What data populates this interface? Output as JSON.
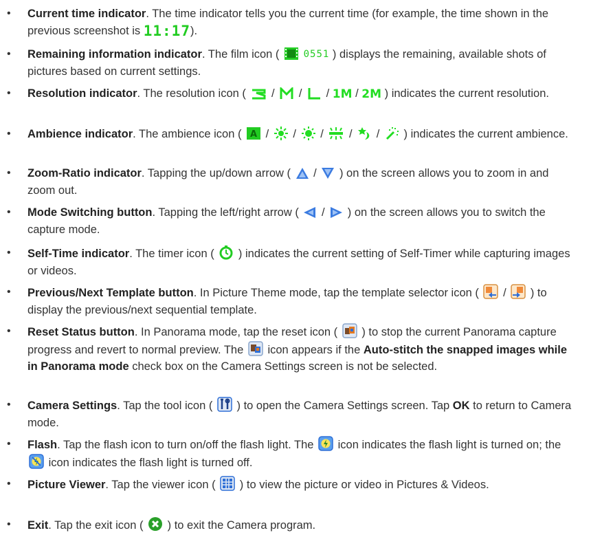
{
  "items": [
    {
      "title": "Current time indicator",
      "text_a": ". The time indicator tells you the current time (for example, the time shown in the previous screenshot is ",
      "time": "11:17",
      "text_b": ")."
    },
    {
      "title": "Remaining information indicator",
      "text_a": ". The film icon ( ",
      "film_count": "0551",
      "text_b": " ) displays the remaining, available shots of pictures based on current settings."
    },
    {
      "title": "Resolution indicator",
      "text_a": ". The resolution icon ( ",
      "res_labels": [
        "1M",
        "2M"
      ],
      "text_b": " ) indicates the current resolution."
    },
    {
      "title": "Ambience indicator",
      "text_a": ". The ambience icon ( ",
      "amb_auto": "A",
      "text_b": " ) indicates the current ambience."
    },
    {
      "title": "Zoom-Ratio indicator",
      "text_a": ". Tapping the up/down arrow ( ",
      "text_b": " ) on the screen allows you to zoom in and zoom out."
    },
    {
      "title": "Mode Switching button",
      "text_a": ". Tapping the left/right arrow ( ",
      "text_b": " ) on the screen allows you to switch the capture mode."
    },
    {
      "title": "Self-Time indicator",
      "text_a": ". The timer icon ( ",
      "text_b": " ) indicates the current setting of Self-Timer while capturing images or videos."
    },
    {
      "title": "Previous/Next Template button",
      "text_a": ". In Picture Theme mode, tap the template selector icon ( ",
      "text_b": " ) to display the previous/next sequential template."
    },
    {
      "title": "Reset Status button",
      "text_a": ". In Panorama mode, tap the reset icon ( ",
      "text_b": " ) to stop the current Panorama capture progress and revert to normal preview. The ",
      "text_c": " icon appears if the ",
      "bold_c": "Auto-stitch the snapped images while in Panorama mode",
      "text_d": " check box on the Camera Settings screen is not be selected."
    },
    {
      "title": "Camera Settings",
      "text_a": ". Tap the tool icon ( ",
      "text_b": " ) to open the Camera Settings screen. Tap ",
      "bold_b": "OK",
      "text_c": " to return to Camera mode."
    },
    {
      "title": "Flash",
      "text_a": ". Tap the flash icon to turn on/off the flash light. The ",
      "text_b": " icon indicates the flash light is turned on; the ",
      "text_c": " icon indicates the flash light is turned off."
    },
    {
      "title": "Picture Viewer",
      "text_a": ". Tap the viewer icon ( ",
      "text_b": " ) to view the picture or video in Pictures & Videos."
    },
    {
      "title": "Exit",
      "text_a": ". Tap the exit icon ( ",
      "text_b": " ) to exit the Camera program."
    }
  ],
  "separator": " / ",
  "bullet_char": "•",
  "colors": {
    "text": "#333333",
    "icon_green": "#22cc22",
    "icon_blue": "#2f6fd6",
    "exit_green": "#2aa02a"
  }
}
